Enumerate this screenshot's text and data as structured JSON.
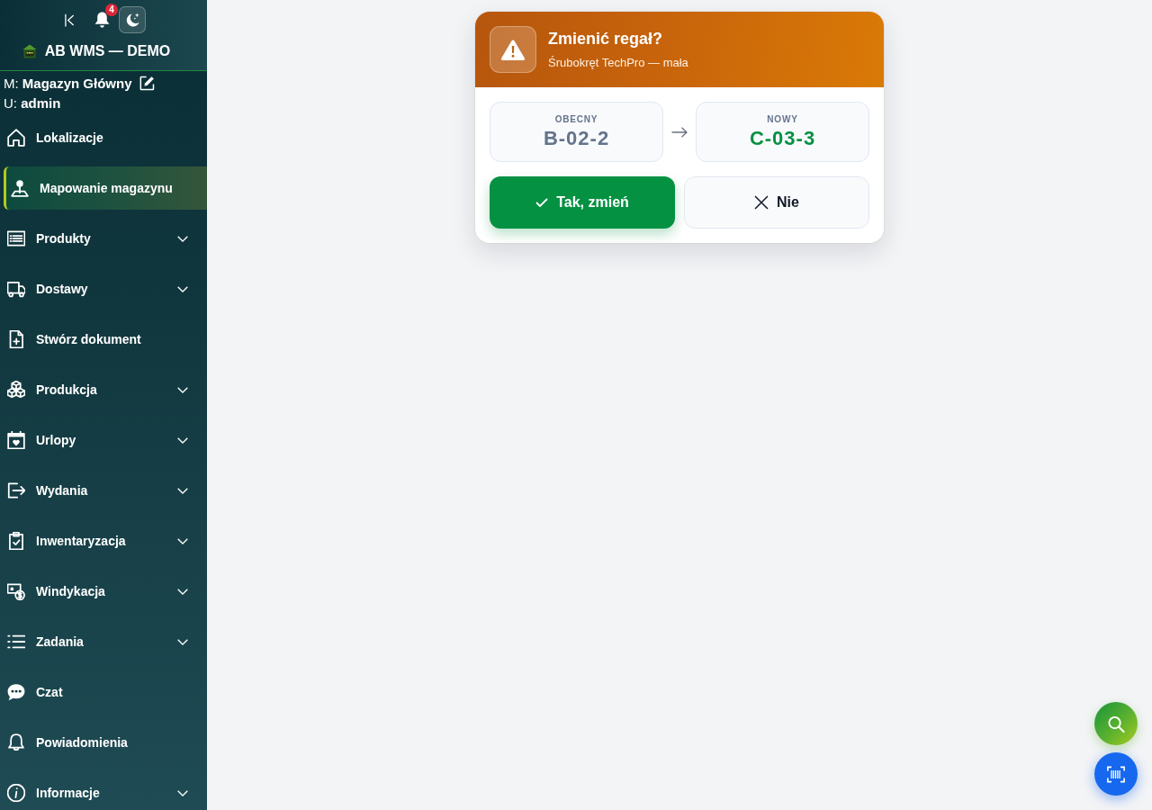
{
  "sidebar": {
    "toolbar": {
      "notification_count": "4"
    },
    "brand": "AB WMS — DEMO",
    "warehouse": "M: **Magazyn Główny**",
    "user": "U: **admin**",
    "nav": [
      {
        "label": "Lokalizacje",
        "selected": false,
        "expandable": false
      },
      {
        "label": "Mapowanie magazynu",
        "selected": true,
        "expandable": false
      },
      {
        "label": "Produkty",
        "selected": false,
        "expandable": true
      },
      {
        "label": "Dostawy",
        "selected": false,
        "expandable": true
      },
      {
        "label": "Stwórz dokument",
        "selected": false,
        "expandable": false
      },
      {
        "label": "Produkcja",
        "selected": false,
        "expandable": true
      },
      {
        "label": "Urlopy",
        "selected": false,
        "expandable": true
      },
      {
        "label": "Wydania",
        "selected": false,
        "expandable": true
      },
      {
        "label": "Inwentaryzacja",
        "selected": false,
        "expandable": true
      },
      {
        "label": "Windykacja",
        "selected": false,
        "expandable": true
      },
      {
        "label": "Zadania",
        "selected": false,
        "expandable": true
      },
      {
        "label": "Czat",
        "selected": false,
        "expandable": false
      },
      {
        "label": "Powiadomienia",
        "selected": false,
        "expandable": false
      },
      {
        "label": "Informacje",
        "selected": false,
        "expandable": true
      }
    ]
  },
  "dialog": {
    "title": "Zmienić regał?",
    "subtitle": "Śrubokręt TechPro — mała",
    "locations": [
      {
        "label": "OBECNY",
        "value": "B-02-2",
        "kind": "current"
      },
      {
        "label": "NOWY",
        "value": "C-03-3",
        "kind": "new"
      }
    ],
    "buttons": [
      {
        "label": "Tak, zmień",
        "kind": "confirm"
      },
      {
        "label": "Nie",
        "kind": "cancel"
      }
    ]
  }
}
